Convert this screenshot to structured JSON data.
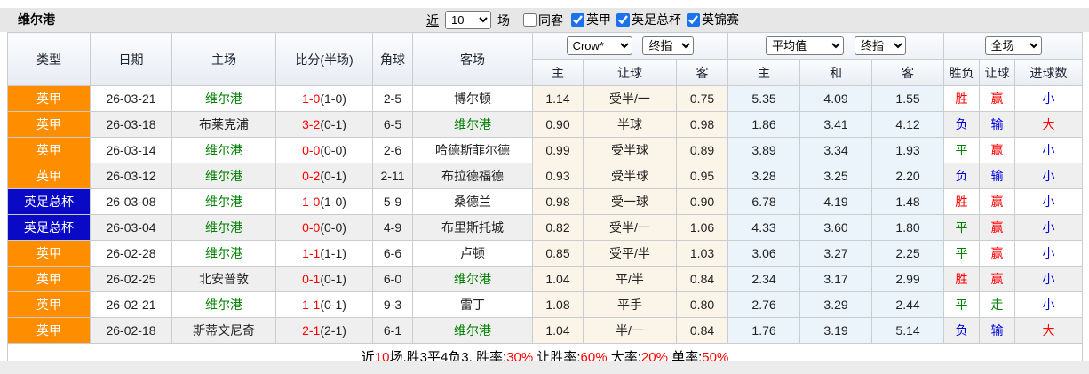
{
  "toolbar": {
    "title": "维尔港",
    "recent_label": "近",
    "recent_value": "10",
    "recent_suffix": "场",
    "same_away_label": "同客",
    "leagues": [
      {
        "label": "英甲",
        "checked": true
      },
      {
        "label": "英足总杯",
        "checked": true
      },
      {
        "label": "英锦赛",
        "checked": true
      }
    ]
  },
  "table": {
    "selects": {
      "odds_company": "Crow*",
      "odds_stage": "终指",
      "avg_label": "平均值",
      "avg_stage": "终指",
      "scope": "全场"
    },
    "columns": {
      "left": [
        "类型",
        "日期",
        "主场",
        "比分(半场)",
        "角球",
        "客场"
      ],
      "odds": [
        "主",
        "让球",
        "客"
      ],
      "avg": [
        "主",
        "和",
        "客"
      ],
      "result": [
        "胜负",
        "让球",
        "进球数"
      ]
    },
    "rows": [
      {
        "type": "英甲",
        "date": "26-03-21",
        "home": "维尔港",
        "score": "1-0",
        "half": "(1-0)",
        "corner": "2-5",
        "away": "博尔顿",
        "odds_home": "1.14",
        "handicap": "受半/一",
        "odds_away": "0.75",
        "avg_home": "5.35",
        "avg_draw": "4.09",
        "avg_away": "1.55",
        "result": "胜",
        "handicap_result": "赢",
        "goals": "小"
      },
      {
        "type": "英甲",
        "date": "26-03-18",
        "home": "布莱克浦",
        "score": "3-2",
        "half": "(0-1)",
        "corner": "6-5",
        "away": "维尔港",
        "odds_home": "0.90",
        "handicap": "半球",
        "odds_away": "0.98",
        "avg_home": "1.86",
        "avg_draw": "3.41",
        "avg_away": "4.12",
        "result": "负",
        "handicap_result": "输",
        "goals": "大"
      },
      {
        "type": "英甲",
        "date": "26-03-14",
        "home": "维尔港",
        "score": "0-0",
        "half": "(0-0)",
        "corner": "2-6",
        "away": "哈德斯菲尔德",
        "odds_home": "0.99",
        "handicap": "受半球",
        "odds_away": "0.89",
        "avg_home": "3.89",
        "avg_draw": "3.34",
        "avg_away": "1.93",
        "result": "平",
        "handicap_result": "赢",
        "goals": "小"
      },
      {
        "type": "英甲",
        "date": "26-03-12",
        "home": "维尔港",
        "score": "0-2",
        "half": "(0-1)",
        "corner": "2-11",
        "away": "布拉德福德",
        "odds_home": "0.93",
        "handicap": "受半球",
        "odds_away": "0.95",
        "avg_home": "3.28",
        "avg_draw": "3.25",
        "avg_away": "2.20",
        "result": "负",
        "handicap_result": "输",
        "goals": "小"
      },
      {
        "type": "英足总杯",
        "date": "26-03-08",
        "home": "维尔港",
        "score": "1-0",
        "half": "(1-0)",
        "corner": "5-9",
        "away": "桑德兰",
        "odds_home": "0.98",
        "handicap": "受一球",
        "odds_away": "0.90",
        "avg_home": "6.78",
        "avg_draw": "4.19",
        "avg_away": "1.48",
        "result": "胜",
        "handicap_result": "赢",
        "goals": "小"
      },
      {
        "type": "英足总杯",
        "date": "26-03-04",
        "home": "维尔港",
        "score": "0-0",
        "half": "(0-0)",
        "corner": "4-9",
        "away": "布里斯托城",
        "odds_home": "0.82",
        "handicap": "受半/一",
        "odds_away": "1.06",
        "avg_home": "4.33",
        "avg_draw": "3.60",
        "avg_away": "1.80",
        "result": "平",
        "handicap_result": "赢",
        "goals": "小"
      },
      {
        "type": "英甲",
        "date": "26-02-28",
        "home": "维尔港",
        "score": "1-1",
        "half": "(1-1)",
        "corner": "6-6",
        "away": "卢顿",
        "odds_home": "0.85",
        "handicap": "受平/半",
        "odds_away": "1.03",
        "avg_home": "3.06",
        "avg_draw": "3.27",
        "avg_away": "2.25",
        "result": "平",
        "handicap_result": "赢",
        "goals": "小"
      },
      {
        "type": "英甲",
        "date": "26-02-25",
        "home": "北安普敦",
        "score": "0-1",
        "half": "(0-1)",
        "corner": "6-0",
        "away": "维尔港",
        "odds_home": "1.04",
        "handicap": "平/半",
        "odds_away": "0.84",
        "avg_home": "2.34",
        "avg_draw": "3.17",
        "avg_away": "2.99",
        "result": "胜",
        "handicap_result": "赢",
        "goals": "小"
      },
      {
        "type": "英甲",
        "date": "26-02-21",
        "home": "维尔港",
        "score": "1-1",
        "half": "(0-1)",
        "corner": "9-3",
        "away": "雷丁",
        "odds_home": "1.08",
        "handicap": "平手",
        "odds_away": "0.80",
        "avg_home": "2.76",
        "avg_draw": "3.29",
        "avg_away": "2.44",
        "result": "平",
        "handicap_result": "走",
        "goals": "小"
      },
      {
        "type": "英甲",
        "date": "26-02-18",
        "home": "斯蒂文尼奇",
        "score": "2-1",
        "half": "(2-1)",
        "corner": "6-1",
        "away": "维尔港",
        "odds_home": "1.04",
        "handicap": "半/一",
        "odds_away": "0.84",
        "avg_home": "1.76",
        "avg_draw": "3.19",
        "avg_away": "5.14",
        "result": "负",
        "handicap_result": "输",
        "goals": "大"
      }
    ],
    "footer_segments": [
      {
        "text": "近",
        "red": false
      },
      {
        "text": "10",
        "red": true
      },
      {
        "text": "场,胜3平4负3, 胜率:",
        "red": false
      },
      {
        "text": "30%",
        "red": true
      },
      {
        "text": " 让胜率:",
        "red": false
      },
      {
        "text": "60%",
        "red": true
      },
      {
        "text": " 大率:",
        "red": false
      },
      {
        "text": "20%",
        "red": true
      },
      {
        "text": " 单率:",
        "red": false
      },
      {
        "text": "50%",
        "red": true
      }
    ]
  },
  "colors": {
    "badge_league_one": "#fe8d00",
    "badge_fa_cup": "#0a0ac6",
    "team_highlight": "#008000",
    "win_text": "#ff0000",
    "draw_text": "#008000",
    "lose_text": "#0000dd",
    "odds_bg": "#fbf4e9",
    "avg_bg": "#eaf4fa",
    "row_alt_bg": "#efefef",
    "toolbar_bg": "#e7e7e7"
  }
}
